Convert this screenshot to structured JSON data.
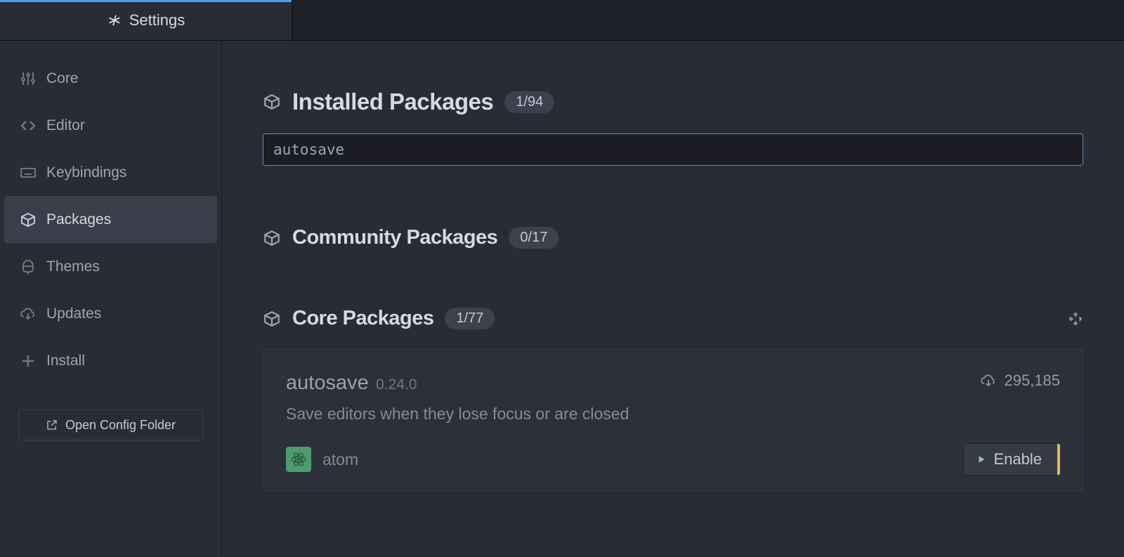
{
  "tab": {
    "label": "Settings"
  },
  "sidebar": {
    "items": [
      {
        "label": "Core"
      },
      {
        "label": "Editor"
      },
      {
        "label": "Keybindings"
      },
      {
        "label": "Packages"
      },
      {
        "label": "Themes"
      },
      {
        "label": "Updates"
      },
      {
        "label": "Install"
      }
    ],
    "open_config": "Open Config Folder"
  },
  "main": {
    "installed": {
      "title": "Installed Packages",
      "count": "1/94"
    },
    "search_value": "autosave",
    "community": {
      "title": "Community Packages",
      "count": "0/17"
    },
    "core": {
      "title": "Core Packages",
      "count": "1/77"
    }
  },
  "package": {
    "name": "autosave",
    "version": "0.24.0",
    "downloads": "295,185",
    "description": "Save editors when they lose focus or are closed",
    "author": "atom",
    "enable_label": "Enable"
  }
}
